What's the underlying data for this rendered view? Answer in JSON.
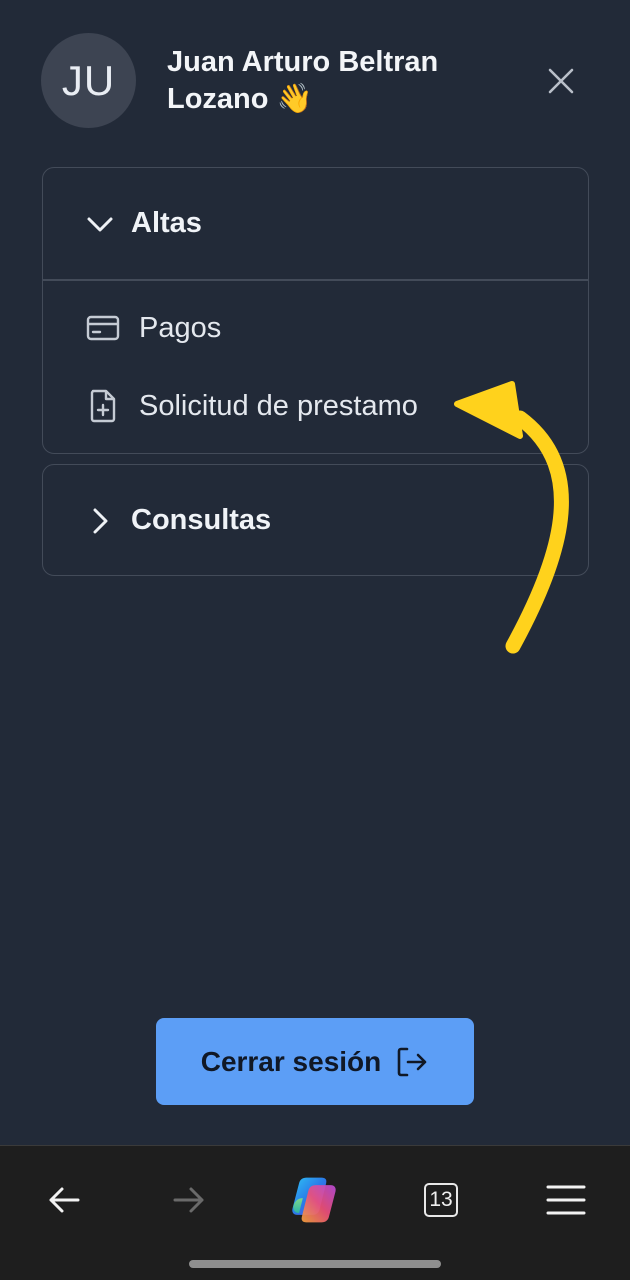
{
  "header": {
    "avatar_initials": "JU",
    "user_name": "Juan Arturo Beltran Lozano 👋",
    "close_icon": "close-icon"
  },
  "menu": {
    "sections": [
      {
        "title": "Altas",
        "expanded": true,
        "items": [
          {
            "label": "Pagos",
            "icon": "credit-card-icon"
          },
          {
            "label": "Solicitud de prestamo",
            "icon": "file-plus-icon"
          }
        ]
      },
      {
        "title": "Consultas",
        "expanded": false,
        "items": []
      }
    ]
  },
  "annotation": {
    "type": "arrow",
    "color": "#ffd21c",
    "points_to": "Solicitud de prestamo"
  },
  "logout": {
    "label": "Cerrar sesión",
    "icon": "logout-icon"
  },
  "browser_toolbar": {
    "tab_count": "13",
    "buttons": [
      "back-icon",
      "forward-icon",
      "copilot-icon",
      "tabs-icon",
      "menu-icon"
    ]
  },
  "colors": {
    "background": "#222a38",
    "panel_border": "#434b59",
    "logout_button": "#5c9ef6",
    "browser_bar": "#1e1e1e"
  }
}
